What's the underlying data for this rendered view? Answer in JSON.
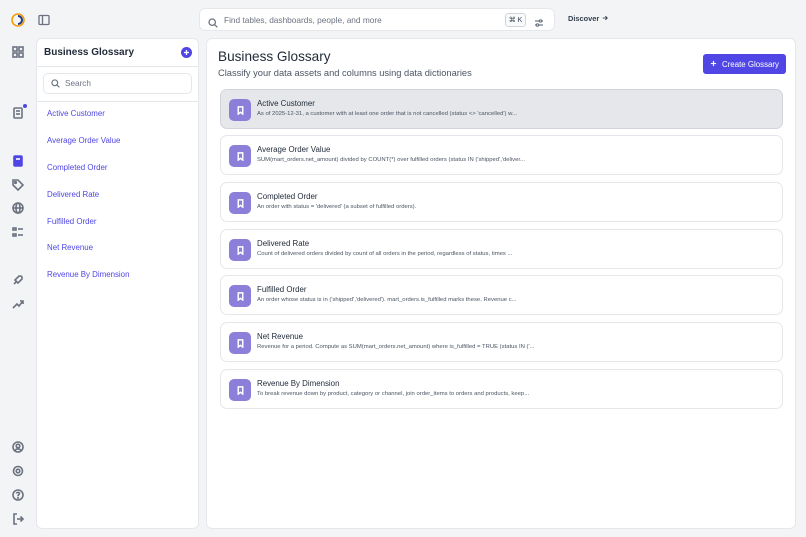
{
  "rail": {
    "icons": [
      "logo-icon",
      "grid-icon",
      "notes-icon",
      "glossary-icon",
      "tag-icon",
      "globe-icon",
      "list-icon",
      "rocket-icon",
      "trend-icon",
      "user-icon",
      "settings-icon",
      "help-icon",
      "logout-icon"
    ]
  },
  "topbar": {
    "search_placeholder": "Find tables, dashboards, people, and more",
    "shortcut": "⌘ K",
    "discover_label": "Discover"
  },
  "glossary_panel": {
    "title": "Business Glossary",
    "search_placeholder": "Search",
    "items": [
      {
        "label": "Active Customer"
      },
      {
        "label": "Average Order Value"
      },
      {
        "label": "Completed Order"
      },
      {
        "label": "Delivered Rate"
      },
      {
        "label": "Fulfilled Order"
      },
      {
        "label": "Net Revenue"
      },
      {
        "label": "Revenue By Dimension"
      }
    ]
  },
  "main": {
    "title": "Business Glossary",
    "subtitle": "Classify your data assets and columns using data dictionaries",
    "create_label": "Create Glossary",
    "cards": [
      {
        "title": "Active Customer",
        "description": "As of 2025-12-31, a customer with at least one order that is not cancelled (status <> 'cancelled') w..."
      },
      {
        "title": "Average Order Value",
        "description": "SUM(mart_orders.net_amount) divided by COUNT(*) over fulfilled orders (status IN ('shipped','deliver..."
      },
      {
        "title": "Completed Order",
        "description": "An order with status = 'delivered' (a subset of fulfilled orders)."
      },
      {
        "title": "Delivered Rate",
        "description": "Count of delivered orders divided by count of all orders in the period, regardless of status, times ..."
      },
      {
        "title": "Fulfilled Order",
        "description": "An order whose status is in ('shipped','delivered'). mart_orders.is_fulfilled marks these. Revenue c..."
      },
      {
        "title": "Net Revenue",
        "description": "Revenue for a period. Compute as SUM(mart_orders.net_amount) where is_fulfilled = TRUE (status IN ('..."
      },
      {
        "title": "Revenue By Dimension",
        "description": "To break revenue down by product, category or channel, join order_items to orders and products, keep..."
      }
    ]
  },
  "colors": {
    "accent": "#4f46e5",
    "badge": "#8b7fd9",
    "background": "#f3f4f6"
  }
}
